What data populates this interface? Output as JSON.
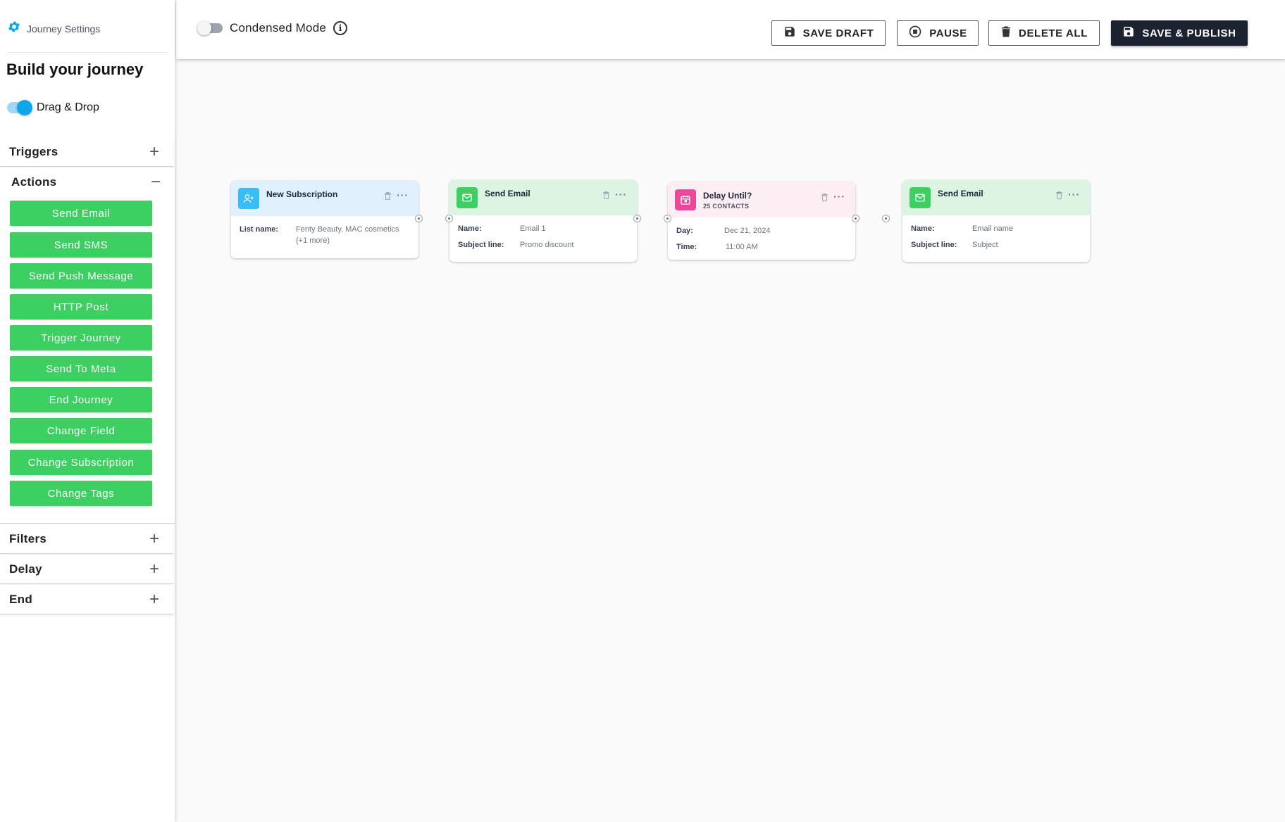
{
  "sidebar": {
    "settings_label": "Journey Settings",
    "title": "Build your journey",
    "drag_drop_label": "Drag & Drop",
    "sections": {
      "triggers": "Triggers",
      "actions": "Actions",
      "filters": "Filters",
      "delay": "Delay",
      "end": "End"
    },
    "actions": [
      "Send Email",
      "Send SMS",
      "Send Push Message",
      "HTTP Post",
      "Trigger Journey",
      "Send To Meta",
      "End Journey",
      "Change Field",
      "Change Subscription",
      "Change Tags"
    ]
  },
  "topbar": {
    "condensed_label": "Condensed Mode",
    "save_draft": "SAVE DRAFT",
    "pause": "PAUSE",
    "delete_all": "DELETE ALL",
    "save_publish": "SAVE & PUBLISH"
  },
  "nodes": [
    {
      "title": "New Subscription",
      "subtitle": "",
      "icon": "user-plus-icon",
      "fields": [
        {
          "key": "List name:",
          "value": "Fenty Beauty, MAC cosmetics (+1 more)"
        }
      ]
    },
    {
      "title": "Send Email",
      "subtitle": "",
      "icon": "mail-icon",
      "fields": [
        {
          "key": "Name:",
          "value": "Email 1"
        },
        {
          "key": "Subject line:",
          "value": "Promo discount"
        }
      ]
    },
    {
      "title": "Delay Until?",
      "subtitle": "25 CONTACTS",
      "icon": "calendar-icon",
      "fields": [
        {
          "key": "Day:",
          "value": "Dec 21, 2024"
        },
        {
          "key": "Time:",
          "value": "11:00 AM"
        }
      ]
    },
    {
      "title": "Send Email",
      "subtitle": "",
      "icon": "mail-icon",
      "fields": [
        {
          "key": "Name:",
          "value": "Email name"
        },
        {
          "key": "Subject line:",
          "value": "Subject"
        }
      ]
    }
  ],
  "colors": {
    "accent": "#0ea5e9",
    "action_green": "#3ecf63",
    "subscription_head": "#e0f0fd",
    "email_head": "#dcf5e3",
    "delay_head": "#fdeef4",
    "publish_dark": "#1b2230"
  }
}
